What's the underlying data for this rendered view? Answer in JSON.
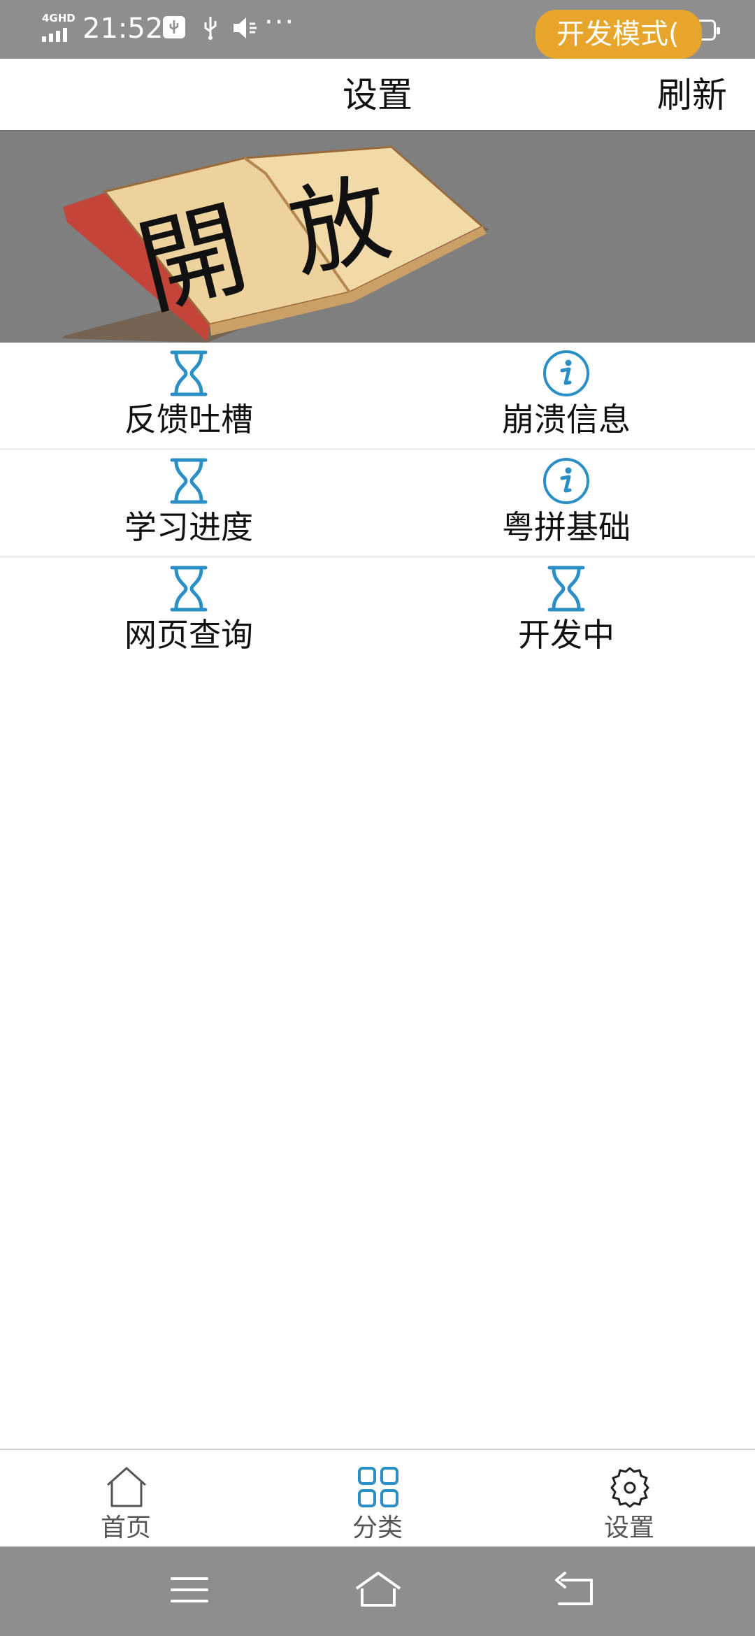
{
  "status_bar": {
    "network": "4GHD",
    "time": "21:52",
    "more": "···",
    "dev_pill": "开发模式("
  },
  "header": {
    "title": "设置",
    "refresh_label": "刷新"
  },
  "banner": {
    "image": "open-book-illustration",
    "logo_text": "開放"
  },
  "grid": {
    "rows": [
      [
        {
          "icon": "hourglass-icon",
          "label": "反馈吐槽"
        },
        {
          "icon": "info-icon",
          "label": "崩溃信息"
        }
      ],
      [
        {
          "icon": "hourglass-icon",
          "label": "学习进度"
        },
        {
          "icon": "info-icon",
          "label": "粤拼基础"
        }
      ],
      [
        {
          "icon": "hourglass-icon",
          "label": "网页查询"
        },
        {
          "icon": "hourglass-icon",
          "label": "开发中"
        }
      ]
    ]
  },
  "bottom_nav": {
    "items": [
      {
        "icon": "home-icon",
        "label": "首页"
      },
      {
        "icon": "grid-icon",
        "label": "分类"
      },
      {
        "icon": "gear-icon",
        "label": "设置"
      }
    ],
    "active_index": 2
  },
  "system_nav": {
    "items": [
      "menu-icon",
      "home-icon",
      "back-icon"
    ]
  },
  "colors": {
    "accent": "#2b8fc7",
    "status_bar_bg": "#8e8e8e",
    "banner_bg": "#7f7f7f",
    "dev_pill_bg": "#e7a52b"
  }
}
